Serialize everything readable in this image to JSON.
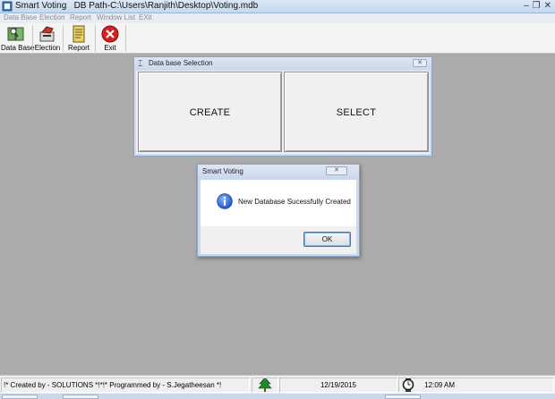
{
  "window": {
    "title": "Smart Voting   DB Path-C:\\Users\\Ranjith\\Desktop\\Voting.mdb",
    "controls": [
      "–",
      "❐",
      "✕"
    ]
  },
  "menu": {
    "items": [
      "Data Base",
      "Election",
      "Report",
      "Window List",
      "EXit"
    ]
  },
  "toolbar": {
    "buttons": [
      {
        "label": "Data Base",
        "icon": "database-book-icon"
      },
      {
        "label": "Election",
        "icon": "election-icon"
      },
      {
        "label": "Report",
        "icon": "report-icon"
      },
      {
        "label": "Exit",
        "icon": "exit-icon"
      }
    ]
  },
  "db_selection": {
    "title": "Data base Selection",
    "create_label": "CREATE",
    "select_label": "SELECT"
  },
  "message_box": {
    "title": "Smart Voting",
    "message": "New Database Sucessfully Created",
    "ok_label": "OK",
    "icon": "info-icon"
  },
  "statusbar": {
    "credits": "!* Created by - SOLUTIONS *!*!* Programmed by - S.Jegatheesan *!",
    "date": "12/19/2015",
    "time": "12:09 AM"
  }
}
